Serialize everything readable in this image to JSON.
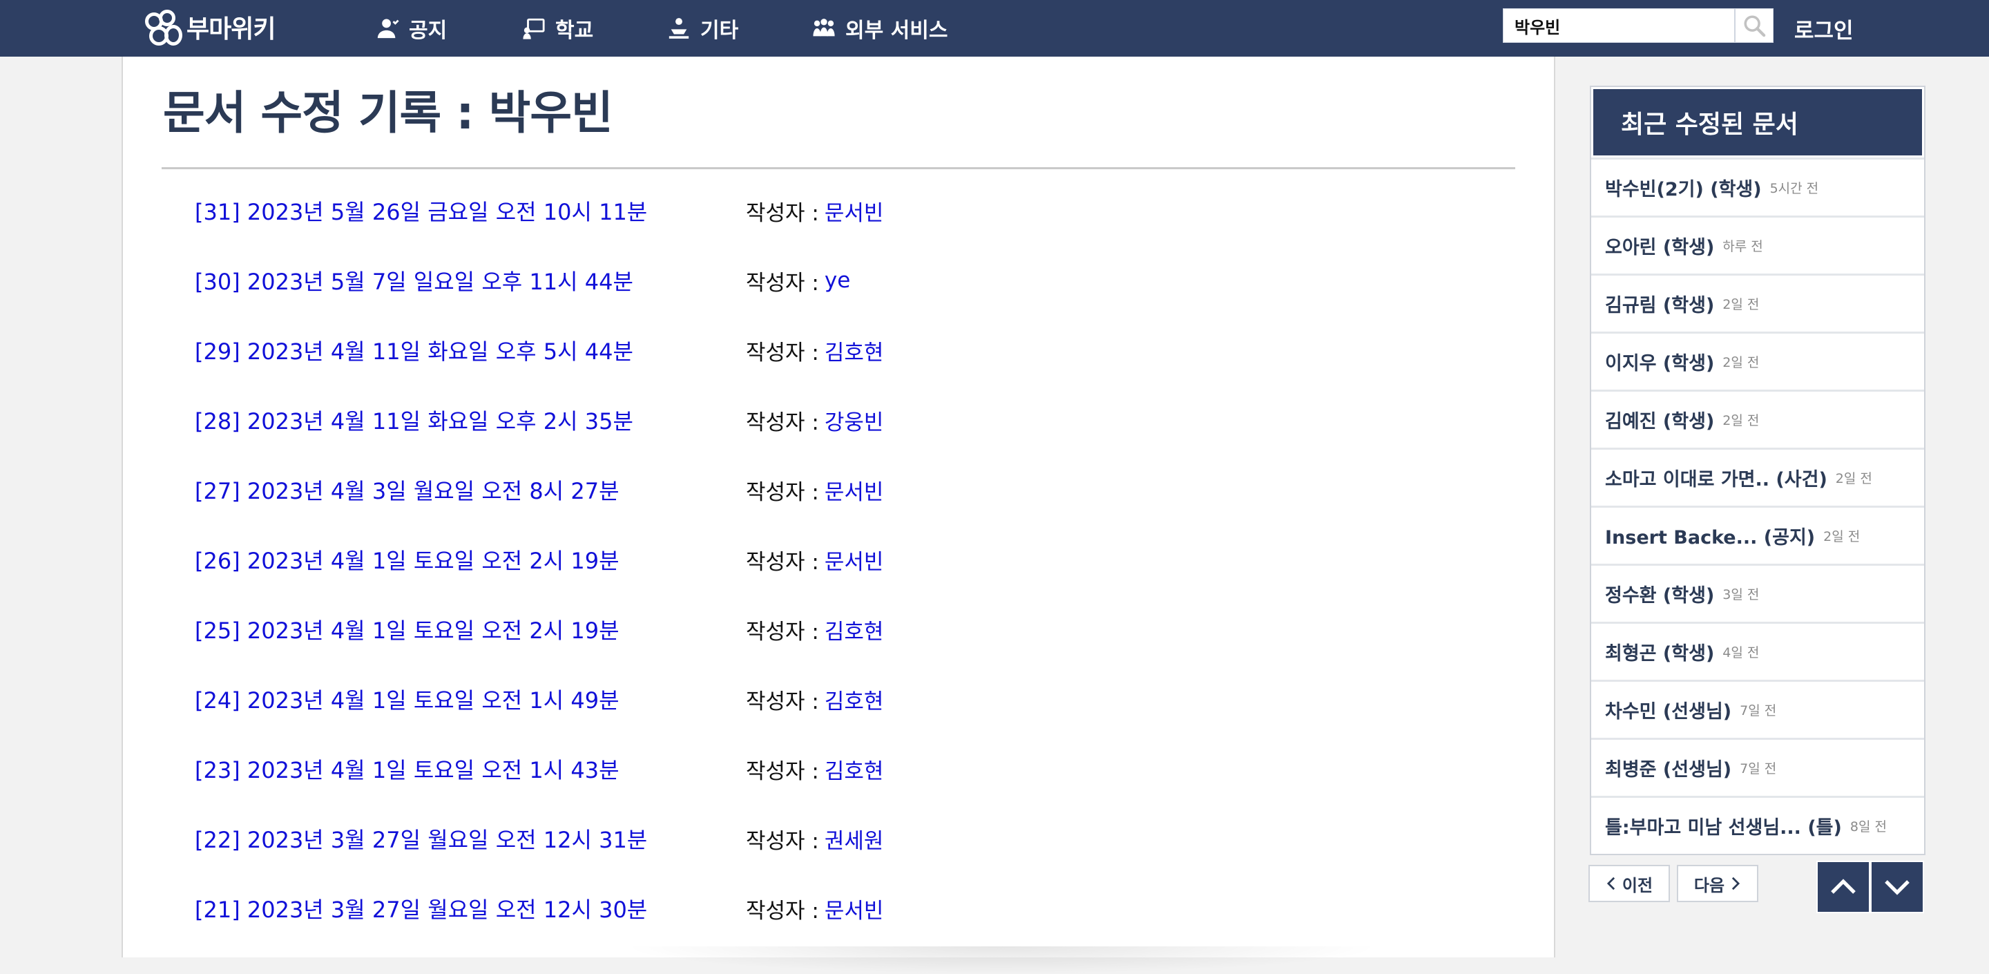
{
  "nav": {
    "logo_text": "부마위키",
    "items": [
      {
        "label": "공지",
        "icon": "user-icon"
      },
      {
        "label": "학교",
        "icon": "school-icon"
      },
      {
        "label": "기타",
        "icon": "misc-icon"
      },
      {
        "label": "외부 서비스",
        "icon": "users-icon"
      }
    ],
    "search_value": "박우빈",
    "login_label": "로그인"
  },
  "page": {
    "title": "문서 수정 기록 : 박우빈",
    "author_prefix": "작성자 :",
    "revisions": [
      {
        "label": "[31] 2023년 5월 26일 금요일 오전 10시 11분",
        "author": "문서빈"
      },
      {
        "label": "[30] 2023년 5월 7일 일요일 오후 11시 44분",
        "author": "ye"
      },
      {
        "label": "[29] 2023년 4월 11일 화요일 오후 5시 44분",
        "author": "김호현"
      },
      {
        "label": "[28] 2023년 4월 11일 화요일 오후 2시 35분",
        "author": "강웅빈"
      },
      {
        "label": "[27] 2023년 4월 3일 월요일 오전 8시 27분",
        "author": "문서빈"
      },
      {
        "label": "[26] 2023년 4월 1일 토요일 오전 2시 19분",
        "author": "문서빈"
      },
      {
        "label": "[25] 2023년 4월 1일 토요일 오전 2시 19분",
        "author": "김호현"
      },
      {
        "label": "[24] 2023년 4월 1일 토요일 오전 1시 49분",
        "author": "김호현"
      },
      {
        "label": "[23] 2023년 4월 1일 토요일 오전 1시 43분",
        "author": "김호현"
      },
      {
        "label": "[22] 2023년 3월 27일 월요일 오전 12시 31분",
        "author": "권세원"
      },
      {
        "label": "[21] 2023년 3월 27일 월요일 오전 12시 30분",
        "author": "문서빈"
      }
    ]
  },
  "sidebar": {
    "title": "최근 수정된 문서",
    "items": [
      {
        "title": "박수빈(2기) (학생)",
        "time": "5시간 전"
      },
      {
        "title": "오아린 (학생)",
        "time": "하루 전"
      },
      {
        "title": "김규림 (학생)",
        "time": "2일 전"
      },
      {
        "title": "이지우 (학생)",
        "time": "2일 전"
      },
      {
        "title": "김예진 (학생)",
        "time": "2일 전"
      },
      {
        "title": "소마고 이대로 가면.. (사건)",
        "time": "2일 전"
      },
      {
        "title": "Insert Backe... (공지)",
        "time": "2일 전"
      },
      {
        "title": "정수환 (학생)",
        "time": "3일 전"
      },
      {
        "title": "최형곤 (학생)",
        "time": "4일 전"
      },
      {
        "title": "차수민 (선생님)",
        "time": "7일 전"
      },
      {
        "title": "최병준 (선생님)",
        "time": "7일 전"
      },
      {
        "title": "틀:부마고 미남 선생님... (틀)",
        "time": "8일 전"
      }
    ],
    "prev_label": "이전",
    "next_label": "다음"
  },
  "colors": {
    "nav_bg": "#2e3f63",
    "link": "#1010d8",
    "title": "#2b3a55"
  }
}
